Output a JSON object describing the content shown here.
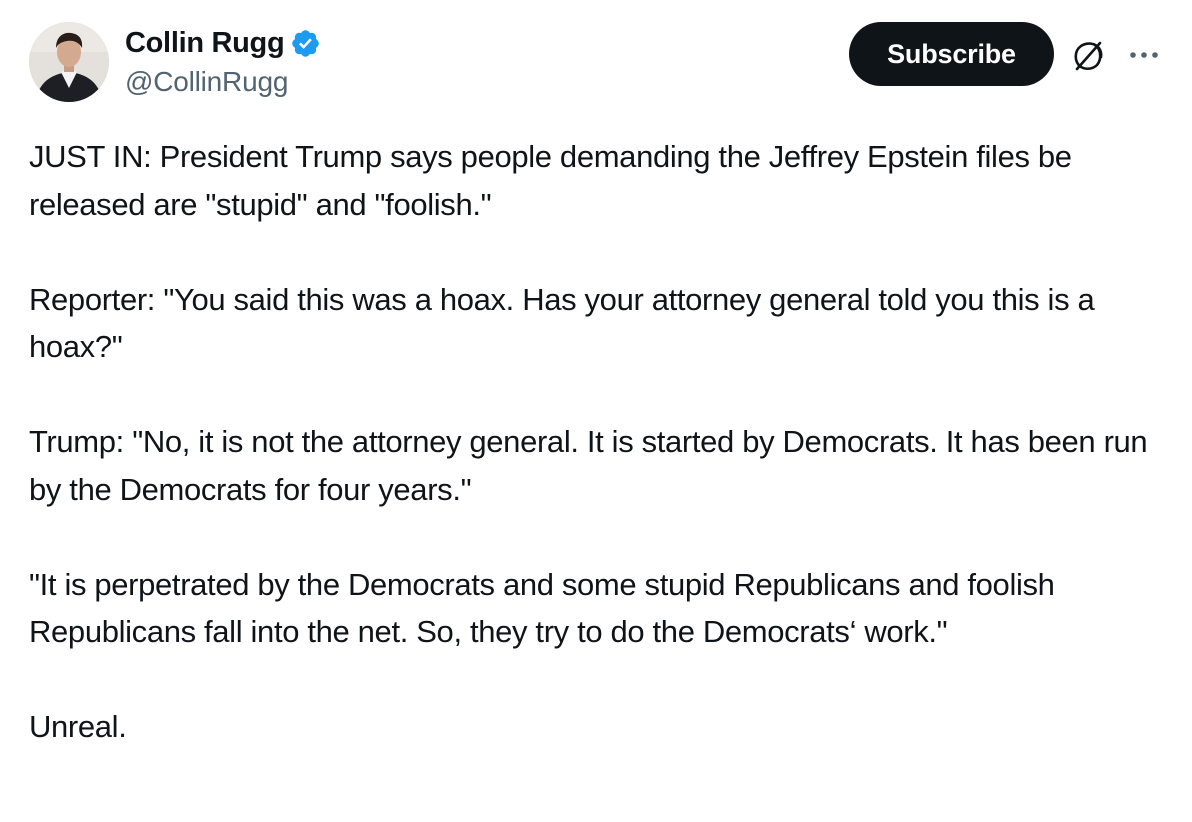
{
  "author": {
    "display_name": "Collin Rugg",
    "handle": "@CollinRugg",
    "verified": true,
    "avatar_icon": "user-avatar-photo"
  },
  "actions": {
    "subscribe_label": "Subscribe",
    "grok_icon": "grok-icon",
    "more_icon": "more-options-icon"
  },
  "tweet": {
    "paragraphs": [
      "JUST IN: President Trump says people demanding the Jeffrey Epstein files be released are \"stupid\" and \"foolish.\"",
      "Reporter: \"You said this was a hoax. Has your attorney general told you this is a hoax?\"",
      "Trump: \"No, it is not the attorney general. It is started by Democrats. It has been run by the Democrats for four years.\"",
      "\"It is perpetrated by the Democrats and some stupid Republicans and foolish Republicans fall into the net. So, they try to do the Democrats‘ work.\"",
      "Unreal."
    ]
  },
  "colors": {
    "text": "#0f1419",
    "secondary_text": "#536471",
    "verified_badge": "#1d9bf0",
    "button_bg": "#0f1419",
    "button_text": "#ffffff"
  }
}
